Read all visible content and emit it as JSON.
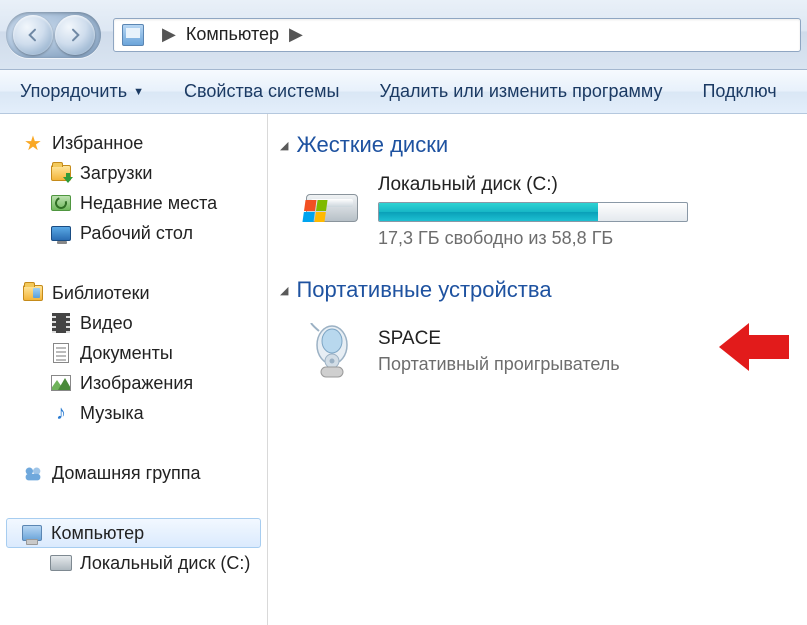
{
  "nav": {
    "breadcrumb_root": "Компьютер"
  },
  "toolbar": {
    "organize": "Упорядочить",
    "system_props": "Свойства системы",
    "uninstall": "Удалить или изменить программу",
    "connect": "Подключ"
  },
  "sidebar": {
    "favorites": {
      "label": "Избранное",
      "items": [
        {
          "label": "Загрузки"
        },
        {
          "label": "Недавние места"
        },
        {
          "label": "Рабочий стол"
        }
      ]
    },
    "libraries": {
      "label": "Библиотеки",
      "items": [
        {
          "label": "Видео"
        },
        {
          "label": "Документы"
        },
        {
          "label": "Изображения"
        },
        {
          "label": "Музыка"
        }
      ]
    },
    "homegroup": {
      "label": "Домашняя группа"
    },
    "computer": {
      "label": "Компьютер",
      "items": [
        {
          "label": "Локальный диск (C:)"
        }
      ]
    }
  },
  "content": {
    "hard_drives": {
      "header": "Жесткие диски",
      "items": [
        {
          "title": "Локальный диск (C:)",
          "free_text": "17,3 ГБ свободно из 58,8 ГБ",
          "free_gb": 17.3,
          "total_gb": 58.8,
          "fill_percent": 71
        }
      ]
    },
    "portable_devices": {
      "header": "Портативные устройства",
      "items": [
        {
          "title": "SPACE",
          "subtitle": "Портативный проигрыватель"
        }
      ]
    }
  }
}
